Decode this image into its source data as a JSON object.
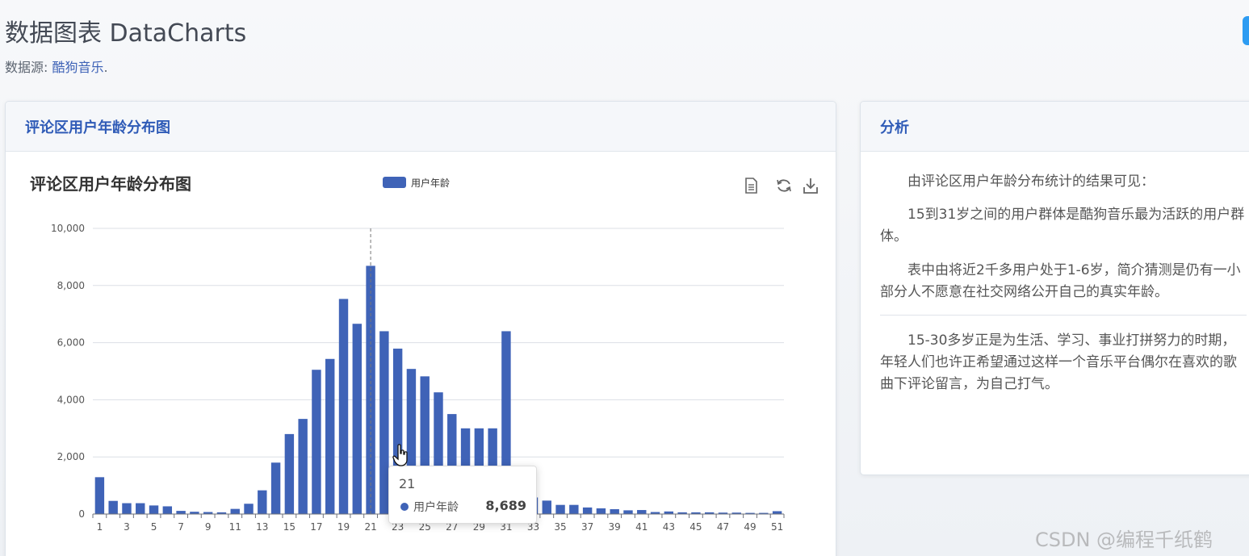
{
  "page": {
    "title": "数据图表 DataCharts",
    "source_label": "数据源:",
    "source_link": "酷狗音乐",
    "source_suffix": "."
  },
  "left_card": {
    "header": "评论区用户年龄分布图"
  },
  "right_card": {
    "header": "分析",
    "paragraphs": [
      "由评论区用户年龄分布统计的结果可见：",
      "15到31岁之间的用户群体是酷狗音乐最为活跃的用户群体。",
      "表中由将近2千多用户处于1-6岁，简介猜测是仍有一小部分人不愿意在社交网络公开自己的真实年龄。",
      "15-30多岁正是为生活、学习、事业打拼努力的时期，年轻人们也许正希望通过这样一个音乐平台偶尔在喜欢的歌曲下评论留言，为自己打气。"
    ]
  },
  "tooltip": {
    "category": "21",
    "series": "用户年龄",
    "value": "8,689"
  },
  "toolbox": [
    "data-view-icon",
    "refresh-icon",
    "download-icon"
  ],
  "watermark": "CSDN @编程千纸鹤",
  "colors": {
    "bar": "#3f63b7",
    "accent": "#2f5bb7",
    "corner_button": "#2d9cf2"
  },
  "chart_data": {
    "type": "bar",
    "title": "评论区用户年龄分布图",
    "legend": "用户年龄",
    "legend_position": "top-center",
    "categories": [
      "1",
      "2",
      "3",
      "4",
      "5",
      "6",
      "7",
      "8",
      "9",
      "10",
      "11",
      "12",
      "13",
      "14",
      "15",
      "16",
      "17",
      "18",
      "19",
      "20",
      "21",
      "22",
      "23",
      "24",
      "25",
      "26",
      "27",
      "28",
      "29",
      "30",
      "31",
      "32",
      "33",
      "34",
      "35",
      "36",
      "37",
      "38",
      "39",
      "40",
      "41",
      "42",
      "43",
      "44",
      "45",
      "46",
      "47",
      "48",
      "49",
      "50",
      "51"
    ],
    "x_tick_labels": [
      "1",
      "3",
      "5",
      "7",
      "9",
      "11",
      "13",
      "15",
      "17",
      "19",
      "21",
      "23",
      "25",
      "27",
      "29",
      "31",
      "33",
      "35",
      "37",
      "39",
      "41",
      "43",
      "45",
      "47",
      "49",
      "51"
    ],
    "series": [
      {
        "name": "用户年龄",
        "values": [
          1290,
          460,
          380,
          380,
          300,
          270,
          110,
          80,
          70,
          60,
          180,
          360,
          830,
          1800,
          2800,
          3330,
          5050,
          5430,
          7530,
          6660,
          8689,
          6400,
          5790,
          5080,
          4820,
          4260,
          3500,
          3000,
          3000,
          3000,
          6400,
          830,
          580,
          470,
          320,
          320,
          230,
          200,
          170,
          130,
          140,
          70,
          90,
          60,
          60,
          60,
          50,
          50,
          40,
          40,
          100
        ]
      }
    ],
    "y_ticks": [
      "0",
      "2,000",
      "4,000",
      "6,000",
      "8,000",
      "10,000"
    ],
    "ylim": [
      0,
      10000
    ],
    "grid": true,
    "highlighted_category": "21"
  }
}
